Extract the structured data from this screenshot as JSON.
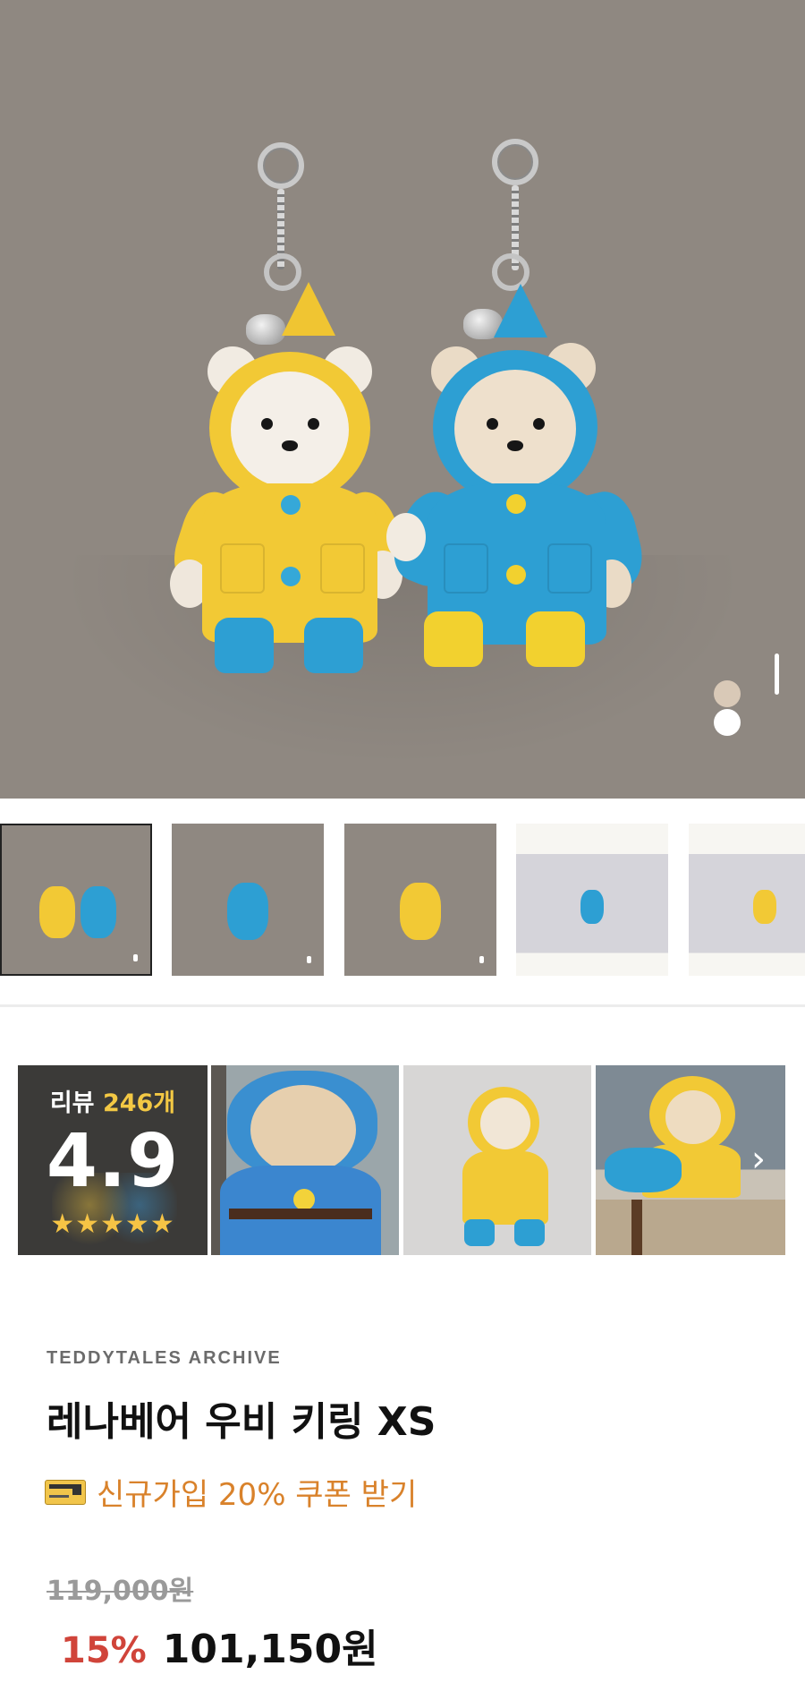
{
  "gallery": {
    "page_indicator": 1,
    "color_dots": [
      "#d9c9b7",
      "#ffffff"
    ],
    "thumbnails": [
      {
        "label": "both-bears",
        "selected": true
      },
      {
        "label": "blue-bear"
      },
      {
        "label": "yellow-bear"
      },
      {
        "label": "blue-bear-white-bg"
      },
      {
        "label": "yellow-bear-white-bg"
      }
    ]
  },
  "reviews": {
    "label": "리뷰",
    "count": "246개",
    "rating": "4.9",
    "stars": "★★★★★"
  },
  "product": {
    "brand": "TEDDYTALES ARCHIVE",
    "title": "레나베어 우비 키링 XS",
    "coupon_text": "신규가입 20% 쿠폰 받기",
    "original_price": "119,000원",
    "discount": "15%",
    "sale_price": "101,150원"
  },
  "colors": {
    "accent_coupon": "#d9822b",
    "discount": "#d0443a",
    "star": "#f6c445"
  }
}
